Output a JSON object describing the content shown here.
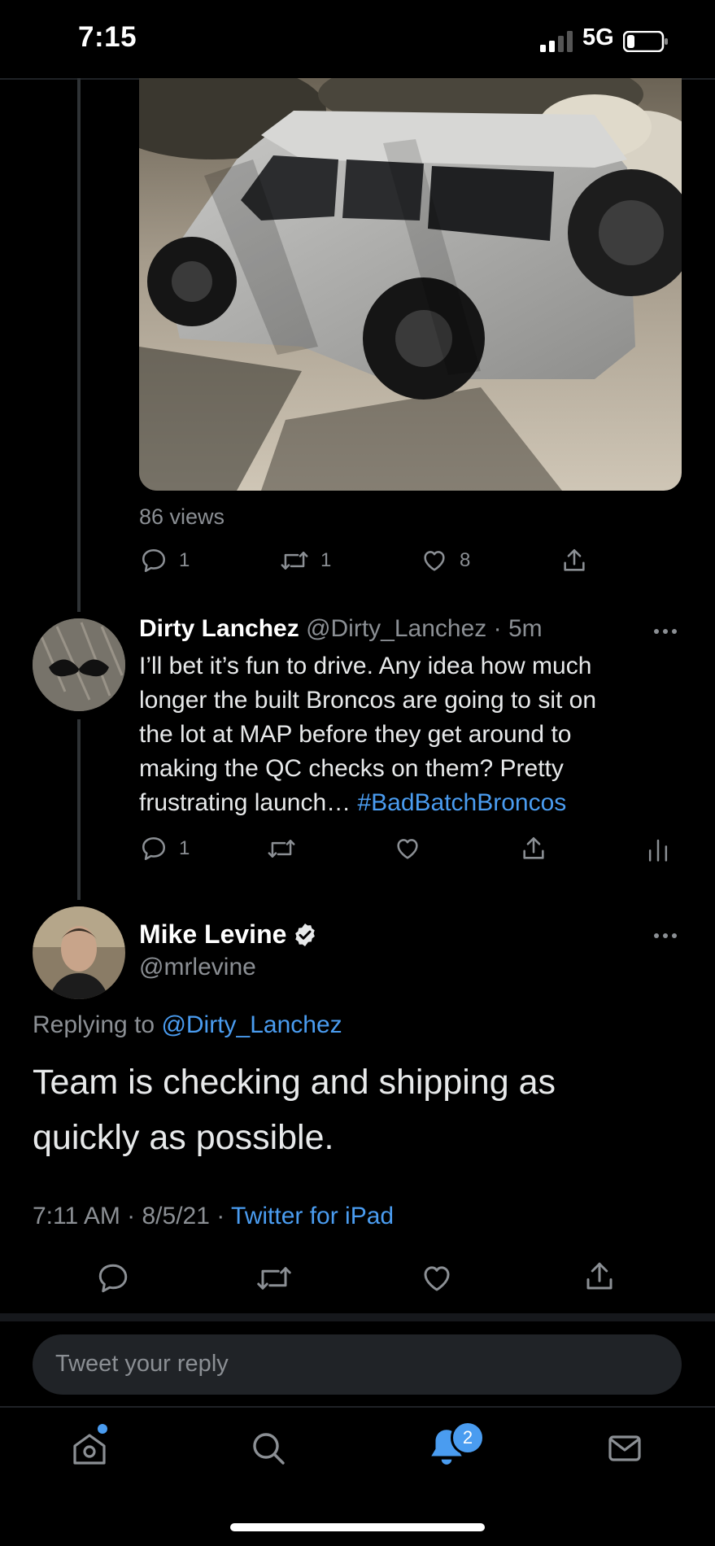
{
  "status_bar": {
    "time": "7:15",
    "network": "5G"
  },
  "parent_tweet": {
    "views": "86 views",
    "reply_count": "1",
    "retweet_count": "1",
    "like_count": "8"
  },
  "reply_tweet": {
    "display_name": "Dirty Lanchez",
    "handle_time": "@Dirty_Lanchez · 5m",
    "text_lines": [
      "I’ll bet it’s fun to drive. Any idea how much",
      "longer the built Broncos are going to sit on",
      "the lot at MAP before they get around to",
      "making the QC checks on them? Pretty"
    ],
    "last_line_text": "frustrating launch… ",
    "hashtag": "#BadBatchBroncos",
    "reply_count": "1"
  },
  "main_tweet": {
    "display_name": "Mike Levine",
    "handle": "@mrlevine",
    "replying_prefix": "Replying to ",
    "replying_to": "@Dirty_Lanchez",
    "text_line1": "Team is checking and shipping as",
    "text_line2": "quickly as possible.",
    "timestamp": "7:11 AM · 8/5/21 · ",
    "source": "Twitter for iPad"
  },
  "reply_input": {
    "placeholder": "Tweet your reply"
  },
  "tab_bar": {
    "notifications_badge": "2"
  },
  "colors": {
    "accent": "#4a9cf0",
    "background": "#000000",
    "muted": "#8b8f94"
  },
  "icons": [
    "reply-icon",
    "retweet-icon",
    "like-icon",
    "share-icon",
    "analytics-icon",
    "verified-icon",
    "more-icon",
    "home-icon",
    "search-icon",
    "bell-icon",
    "mail-icon"
  ]
}
